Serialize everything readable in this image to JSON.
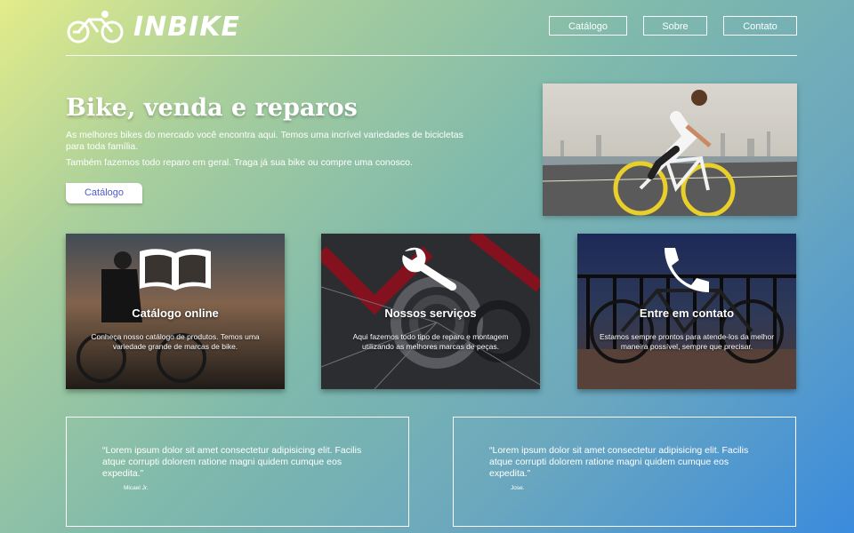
{
  "brand": {
    "name": "INBIKE",
    "logo_icon": "cyclist-go-icon"
  },
  "nav": {
    "items": [
      "Catálogo",
      "Sobre",
      "Contato"
    ]
  },
  "hero": {
    "title": "Bike, venda e reparos",
    "paragraphs": [
      "As melhores bikes do mercado você encontra aqui. Temos uma incrível variedades de bicicletas para toda família.",
      "Também fazemos todo reparo em geral. Traga já sua bike ou compre uma conosco."
    ],
    "button_label": "Catálogo",
    "photo": "cyclist-riding-photo"
  },
  "cards": [
    {
      "icon": "open-book-icon",
      "title": "Catálogo online",
      "text": "Conheça nosso catálogo de produtos. Temos uma variedade grande de marcas de bike."
    },
    {
      "icon": "wrench-icon",
      "title": "Nossos serviços",
      "text": "Aqui fazemos todo tipo de reparo e montagem utilizando as melhores marcas de peças."
    },
    {
      "icon": "phone-icon",
      "title": "Entre em contato",
      "text": "Estamos sempre prontos para atende-los da melhor maneira possível, sempre que precisar."
    }
  ],
  "testimonials": [
    {
      "quote": "“Lorem ipsum dolor sit amet consectetur adipisicing elit. Facilis atque corrupti dolorem ratione magni quidem cumque eos expedita.”",
      "author": "Micael Jr."
    },
    {
      "quote": "“Lorem ipsum dolor sit amet consectetur adipisicing elit. Facilis atque corrupti dolorem ratione magni quidem cumque eos expedita.”",
      "author": "Jose."
    }
  ],
  "colors": {
    "button_text": "#4d5bd0",
    "gradient_start": "#e3ec8a",
    "gradient_end": "#3a8bdd"
  }
}
